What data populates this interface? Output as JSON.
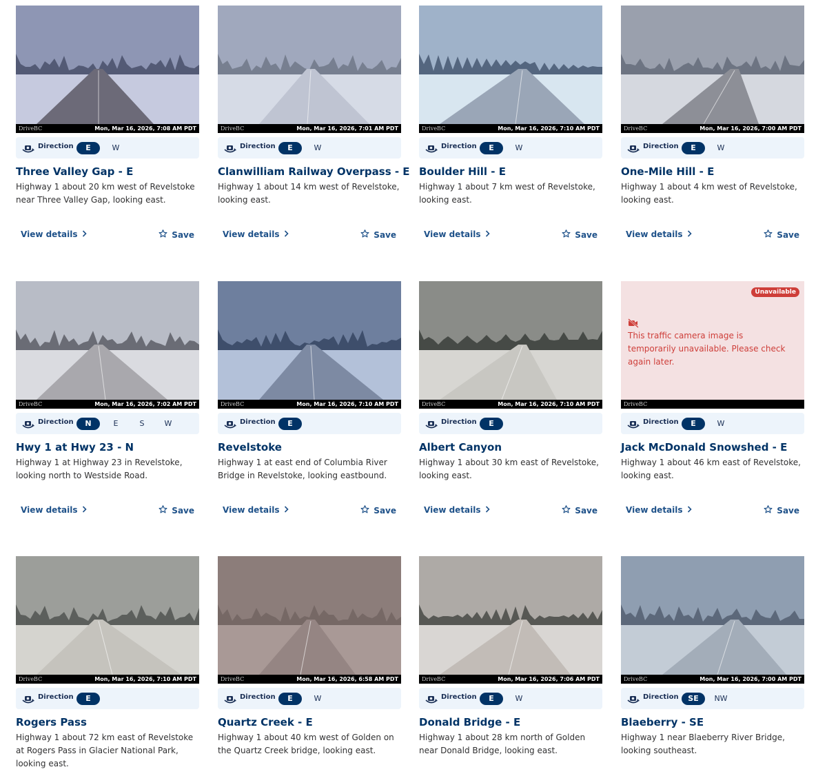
{
  "ui": {
    "direction_label": "Direction",
    "view_details_label": "View details",
    "save_label": "Save",
    "brand_watermark": "DriveBC",
    "unavailable_badge": "Unavailable",
    "unavailable_message": "This traffic camera image is temporarily unavailable. Please check again later."
  },
  "cameras": [
    {
      "title": "Three Valley Gap - E",
      "description": "Highway 1 about 20 km west of Revelstoke near Three Valley Gap, looking east.",
      "timestamp": "Mon, Mar 16, 2026, 7:08 AM PDT",
      "directions": [
        "E",
        "W"
      ],
      "active_direction": "E",
      "image_available": true
    },
    {
      "title": "Clanwilliam Railway Overpass - E",
      "description": "Highway 1 about 14 km west of Revelstoke, looking east.",
      "timestamp": "Mon, Mar 16, 2026, 7:01 AM PDT",
      "directions": [
        "E",
        "W"
      ],
      "active_direction": "E",
      "image_available": true
    },
    {
      "title": "Boulder Hill - E",
      "description": "Highway 1 about 7 km west of Revelstoke, looking east.",
      "timestamp": "Mon, Mar 16, 2026, 7:10 AM PDT",
      "directions": [
        "E",
        "W"
      ],
      "active_direction": "E",
      "image_available": true
    },
    {
      "title": "One-Mile Hill - E",
      "description": "Highway 1 about 4 km west of Revelstoke, looking east.",
      "timestamp": "Mon, Mar 16, 2026, 7:00 AM PDT",
      "directions": [
        "E",
        "W"
      ],
      "active_direction": "E",
      "image_available": true
    },
    {
      "title": "Hwy 1 at Hwy 23 - N",
      "description": "Highway 1 at Highway 23 in Revelstoke, looking north to Westside Road.",
      "timestamp": "Mon, Mar 16, 2026, 7:02 AM PDT",
      "directions": [
        "N",
        "E",
        "S",
        "W"
      ],
      "active_direction": "N",
      "image_available": true
    },
    {
      "title": "Revelstoke",
      "description": "Highway 1 at east end of Columbia River Bridge in Revelstoke, looking eastbound.",
      "timestamp": "Mon, Mar 16, 2026, 7:10 AM PDT",
      "directions": [
        "E"
      ],
      "active_direction": "E",
      "image_available": true
    },
    {
      "title": "Albert Canyon",
      "description": "Highway 1 about 30 km east of Revelstoke, looking east.",
      "timestamp": "Mon, Mar 16, 2026, 7:10 AM PDT",
      "directions": [
        "E"
      ],
      "active_direction": "E",
      "image_available": true
    },
    {
      "title": "Jack McDonald Snowshed - E",
      "description": "Highway 1 about 46 km east of Revelstoke, looking east.",
      "timestamp": "",
      "directions": [
        "E",
        "W"
      ],
      "active_direction": "E",
      "image_available": false
    },
    {
      "title": "Rogers Pass",
      "description": "Highway 1 about 72 km east of Revelstoke at Rogers Pass in Glacier National Park, looking east.",
      "timestamp": "Mon, Mar 16, 2026, 7:10 AM PDT",
      "directions": [
        "E"
      ],
      "active_direction": "E",
      "image_available": true
    },
    {
      "title": "Quartz Creek - E",
      "description": "Highway 1 about 40 km west of Golden on the Quartz Creek bridge, looking east.",
      "timestamp": "Mon, Mar 16, 2026, 6:58 AM PDT",
      "directions": [
        "E",
        "W"
      ],
      "active_direction": "E",
      "image_available": true
    },
    {
      "title": "Donald Bridge - E",
      "description": "Highway 1 about 28 km north of Golden near Donald Bridge, looking east.",
      "timestamp": "Mon, Mar 16, 2026, 7:06 AM PDT",
      "directions": [
        "E",
        "W"
      ],
      "active_direction": "E",
      "image_available": true
    },
    {
      "title": "Blaeberry - SE",
      "description": "Highway 1 near Blaeberry River Bridge, looking southeast.",
      "timestamp": "Mon, Mar 16, 2026, 7:00 AM PDT",
      "directions": [
        "SE",
        "NW"
      ],
      "active_direction": "SE",
      "image_available": true
    }
  ],
  "colors": {
    "accent": "#013366",
    "link": "#1e5189",
    "direction_bar": "#edf4fb",
    "unavailable_bg": "#f4e1e2",
    "unavailable_text": "#ce3e39"
  },
  "icons": {
    "direction": "camera-rotate-icon",
    "view_details": "chevron-right-icon",
    "save": "star-icon",
    "unavailable": "video-slash-icon"
  }
}
